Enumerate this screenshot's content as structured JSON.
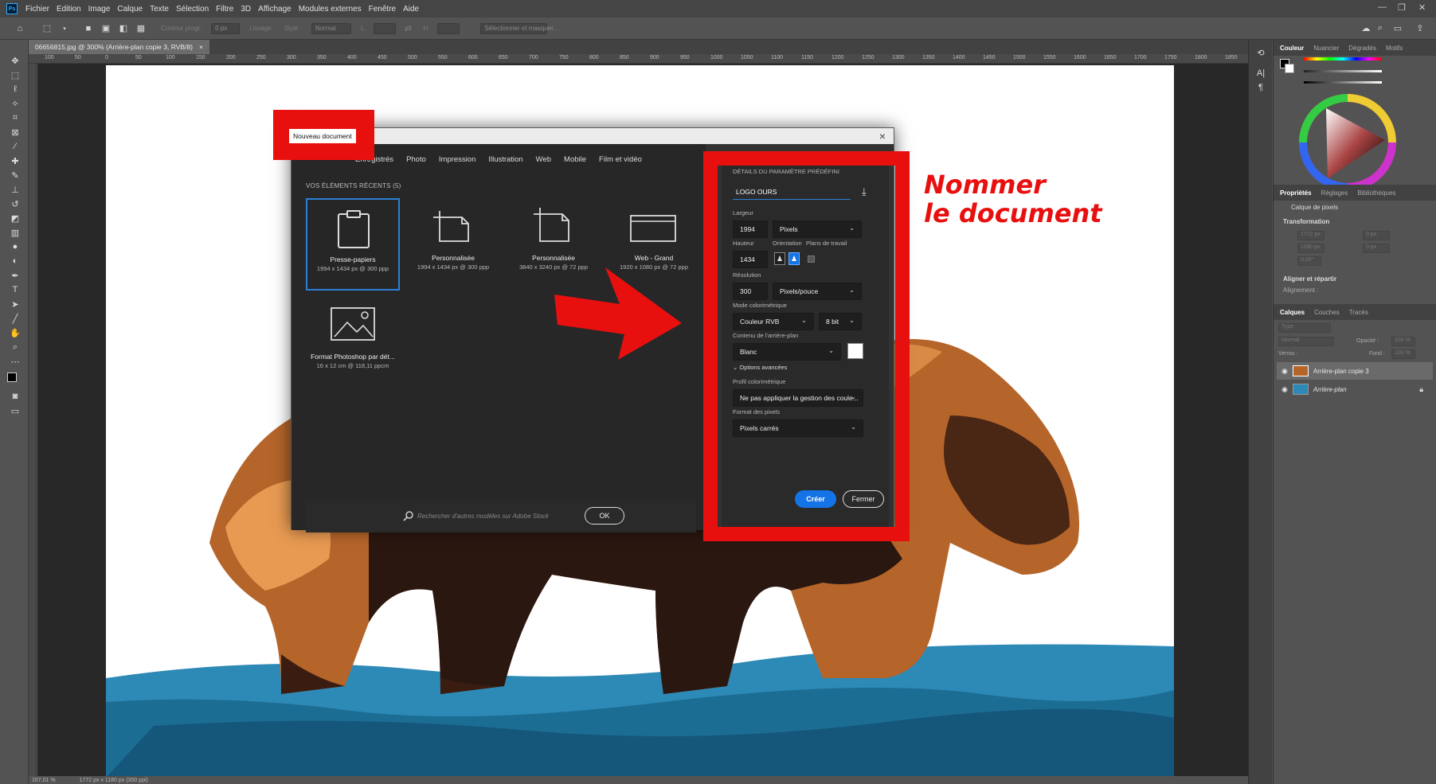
{
  "menubar": {
    "items": [
      "Fichier",
      "Edition",
      "Image",
      "Calque",
      "Texte",
      "Sélection",
      "Filtre",
      "3D",
      "Affichage",
      "Modules externes",
      "Fenêtre",
      "Aide"
    ],
    "window_controls": [
      "—",
      "❐",
      "✕"
    ]
  },
  "options_bar": {
    "contour_label": "Contour progr.",
    "contour_value": "0 px",
    "lissage": "Lissage",
    "style_label": "Style :",
    "style_value": "Normal",
    "l_label": "L",
    "h_label": "H",
    "select_mask": "Sélectionner et masquer..."
  },
  "document_tab": {
    "title": "06656815.jpg @ 300% (Arrière-plan copie 3, RVB/8)",
    "close": "×"
  },
  "ruler_ticks": [
    "100",
    "50",
    "0",
    "50",
    "100",
    "150",
    "200",
    "250",
    "300",
    "350",
    "400",
    "450",
    "500",
    "550",
    "600",
    "650",
    "700",
    "750",
    "800",
    "850",
    "900",
    "950",
    "1000",
    "1050",
    "1100",
    "1150",
    "1200",
    "1250",
    "1300",
    "1350",
    "1400",
    "1450",
    "1500",
    "1550",
    "1600",
    "1650",
    "1700",
    "1750",
    "1800",
    "1850"
  ],
  "status_bar": {
    "zoom": "167,01 %",
    "doc_size": "1772 px x 1180 px (300 ppi)"
  },
  "dialog": {
    "tabs": [
      "Enregistrés",
      "Photo",
      "Impression",
      "Illustration",
      "Web",
      "Mobile",
      "Film et vidéo"
    ],
    "recent_title": "VOS ÉLÉMENTS RÉCENTS (5)",
    "presets": [
      {
        "name": "Presse-papiers",
        "desc": "1994 x 1434 px @ 300 ppp",
        "icon": "clipboard-icon"
      },
      {
        "name": "Personnalisée",
        "desc": "1994 x 1434 px @ 300 ppp",
        "icon": "document-crop-icon"
      },
      {
        "name": "Personnalisée",
        "desc": "3840 x 3240 px @ 72 ppp",
        "icon": "document-crop-icon"
      },
      {
        "name": "Web - Grand",
        "desc": "1920 x 1080 px @ 72 ppp",
        "icon": "browser-window-icon"
      },
      {
        "name": "Format Photoshop par dét...",
        "desc": "16 x 12 cm @ 118,11 ppcm",
        "icon": "image-icon"
      }
    ],
    "search_placeholder": "Rechercher d'autres modèles sur Adobe Stock",
    "ok_label": "OK",
    "details": {
      "title": "DÉTAILS DU PARAMÈTRE PRÉDÉFINI",
      "name_value": "LOGO OURS",
      "width_label": "Largeur",
      "width_value": "1994",
      "width_unit": "Pixels",
      "height_label": "Hauteur",
      "height_value": "1434",
      "orientation_label": "Orientation",
      "artboards_label": "Plans de travail",
      "resolution_label": "Résolution",
      "resolution_value": "300",
      "resolution_unit": "Pixels/pouce",
      "color_mode_label": "Mode colorimétrique",
      "color_mode_value": "Couleur RVB",
      "bit_depth": "8 bit",
      "background_label": "Contenu de l'arrière-plan",
      "background_value": "Blanc",
      "advanced_label": "Options avancées",
      "profile_label": "Profil colorimétrique",
      "profile_value": "Ne pas appliquer la gestion des coule...",
      "pixel_format_label": "Format des pixels",
      "pixel_format_value": "Pixels carrés",
      "create_label": "Créer",
      "close_label": "Fermer"
    }
  },
  "annotation": {
    "title_label": "Nouveau document",
    "instruction_line1": "Nommer",
    "instruction_line2": "le document",
    "accent_color": "#e8100f"
  },
  "right_panel": {
    "color_tabs": [
      "Couleur",
      "Nuancier",
      "Dégradés",
      "Motifs"
    ],
    "props_tabs": [
      "Propriétés",
      "Réglages",
      "Bibliothèques"
    ],
    "layer_type": "Calque de pixels",
    "transformation": "Transformation",
    "transform_w": "1772 px",
    "transform_h": "1180 px",
    "transform_x": "0 px",
    "transform_y": "0 px",
    "transform_angle": "0,00°",
    "align_title": "Aligner et répartir",
    "align_sub": "Alignement :",
    "layers_tabs": [
      "Calques",
      "Couches",
      "Tracés"
    ],
    "layer_search": "Type",
    "blend_mode": "Normal",
    "opacity_label": "Opacité :",
    "opacity_value": "100 %",
    "lock_label": "Verrou :",
    "fill_label": "Fond :",
    "fill_value": "100 %",
    "layers": [
      {
        "name": "Arrière-plan copie 3",
        "selected": true
      },
      {
        "name": "Arrière-plan",
        "selected": false
      }
    ]
  }
}
